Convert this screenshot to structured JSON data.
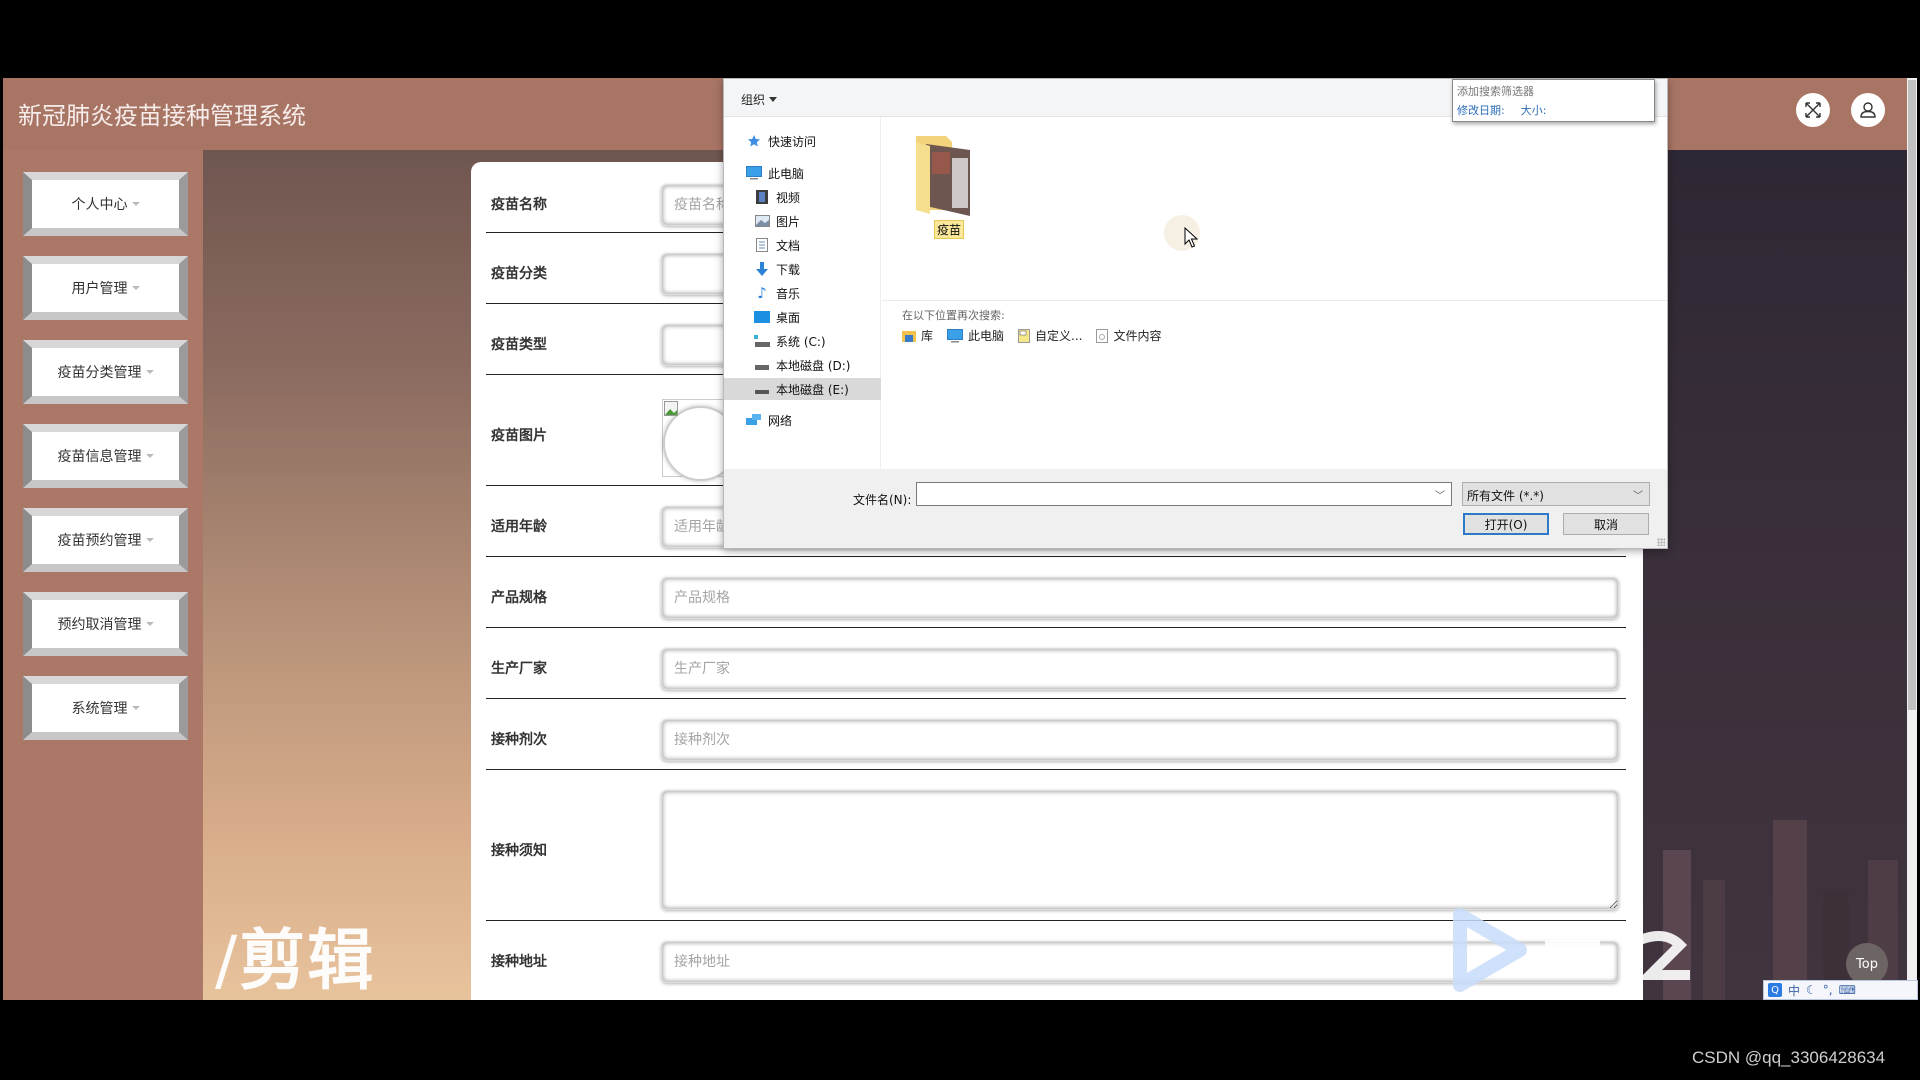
{
  "app": {
    "title": "新冠肺炎疫苗接种管理系统"
  },
  "header": {
    "fullscreen_icon": "fullscreen-icon",
    "user_icon": "user-icon"
  },
  "sidebar": {
    "items": [
      {
        "label": "个人中心"
      },
      {
        "label": "用户管理"
      },
      {
        "label": "疫苗分类管理"
      },
      {
        "label": "疫苗信息管理"
      },
      {
        "label": "疫苗预约管理"
      },
      {
        "label": "预约取消管理"
      },
      {
        "label": "系统管理"
      }
    ]
  },
  "form": {
    "fields": [
      {
        "label": "疫苗名称",
        "placeholder": "疫苗名称",
        "value": ""
      },
      {
        "label": "疫苗分类",
        "placeholder": "",
        "value": ""
      },
      {
        "label": "疫苗类型",
        "placeholder": "",
        "value": ""
      },
      {
        "label": "疫苗图片"
      },
      {
        "label": "适用年龄",
        "placeholder": "适用年龄",
        "value": ""
      },
      {
        "label": "产品规格",
        "placeholder": "产品规格",
        "value": ""
      },
      {
        "label": "生产厂家",
        "placeholder": "生产厂家",
        "value": ""
      },
      {
        "label": "接种剂次",
        "placeholder": "接种剂次",
        "value": ""
      },
      {
        "label": "接种须知",
        "placeholder": "",
        "value": ""
      },
      {
        "label": "接种地址",
        "placeholder": "接种地址",
        "value": ""
      }
    ]
  },
  "file_dialog": {
    "toolbar": {
      "organize_label": "组织"
    },
    "search_filter": {
      "title": "添加搜索筛选器",
      "links": [
        "修改日期:",
        "大小:"
      ]
    },
    "nav": {
      "items": [
        {
          "label": "快速访问",
          "icon": "star-icon"
        },
        {
          "label": "此电脑",
          "icon": "computer-icon"
        },
        {
          "label": "视频",
          "icon": "video-icon"
        },
        {
          "label": "图片",
          "icon": "picture-icon"
        },
        {
          "label": "文档",
          "icon": "document-icon"
        },
        {
          "label": "下载",
          "icon": "download-icon"
        },
        {
          "label": "音乐",
          "icon": "music-icon"
        },
        {
          "label": "桌面",
          "icon": "desktop-icon"
        },
        {
          "label": "系统 (C:)",
          "icon": "drive-c-icon"
        },
        {
          "label": "本地磁盘 (D:)",
          "icon": "drive-icon"
        },
        {
          "label": "本地磁盘 (E:)",
          "icon": "drive-icon",
          "selected": true
        },
        {
          "label": "网络",
          "icon": "network-icon"
        }
      ]
    },
    "files": [
      {
        "name": "疫苗",
        "type": "folder"
      }
    ],
    "search_again": {
      "label": "在以下位置再次搜索:",
      "locations": [
        {
          "label": "库",
          "icon": "library-icon"
        },
        {
          "label": "此电脑",
          "icon": "computer-icon"
        },
        {
          "label": "自定义...",
          "icon": "custom-icon"
        },
        {
          "label": "文件内容",
          "icon": "file-content-icon"
        }
      ]
    },
    "footer": {
      "filename_label": "文件名(N):",
      "filename_value": "",
      "filetype_value": "所有文件 (*.*)",
      "open_label": "打开(O)",
      "cancel_label": "取消"
    }
  },
  "top_button": {
    "label": "Top"
  },
  "watermark": {
    "text": "剪辑"
  },
  "ime_bar": {
    "items": [
      "中",
      "☾",
      "°,",
      "⌨",
      "⁺⁄₋",
      "🔧"
    ]
  },
  "csdn_label": "CSDN @qq_3306428634"
}
